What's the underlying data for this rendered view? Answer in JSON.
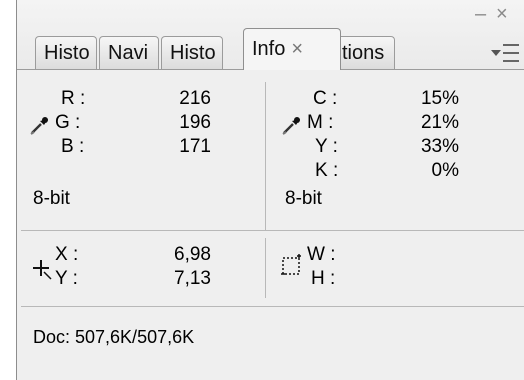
{
  "window": {
    "minimize": "–",
    "close": "×"
  },
  "tabs": [
    {
      "label": "Histo",
      "active": false
    },
    {
      "label": "Navi",
      "active": false
    },
    {
      "label": "Histo",
      "active": false
    },
    {
      "label": "Info",
      "active": true,
      "close": "×"
    },
    {
      "label": "tions",
      "active": false
    }
  ],
  "info": {
    "rgb": {
      "r_label": "R :",
      "r_value": "216",
      "g_label": "G :",
      "g_value": "196",
      "b_label": "B :",
      "b_value": "171",
      "mode": "8-bit"
    },
    "cmyk": {
      "c_label": "C :",
      "c_value": "15%",
      "m_label": "M :",
      "m_value": "21%",
      "y_label": "Y :",
      "y_value": "33%",
      "k_label": "K :",
      "k_value": "0%",
      "mode": "8-bit"
    },
    "position": {
      "x_label": "X :",
      "x_value": "6,98",
      "y_label": "Y :",
      "y_value": "7,13"
    },
    "size": {
      "w_label": "W :",
      "w_value": "",
      "h_label": "H :",
      "h_value": ""
    },
    "doc": "Doc: 507,6K/507,6K"
  },
  "icons": {
    "eyedropper_left": "eyedropper-icon",
    "eyedropper_right": "eyedropper-icon",
    "crosshair": "crosshair-icon",
    "selection": "selection-size-icon",
    "panel_menu": "panel-menu-icon"
  }
}
